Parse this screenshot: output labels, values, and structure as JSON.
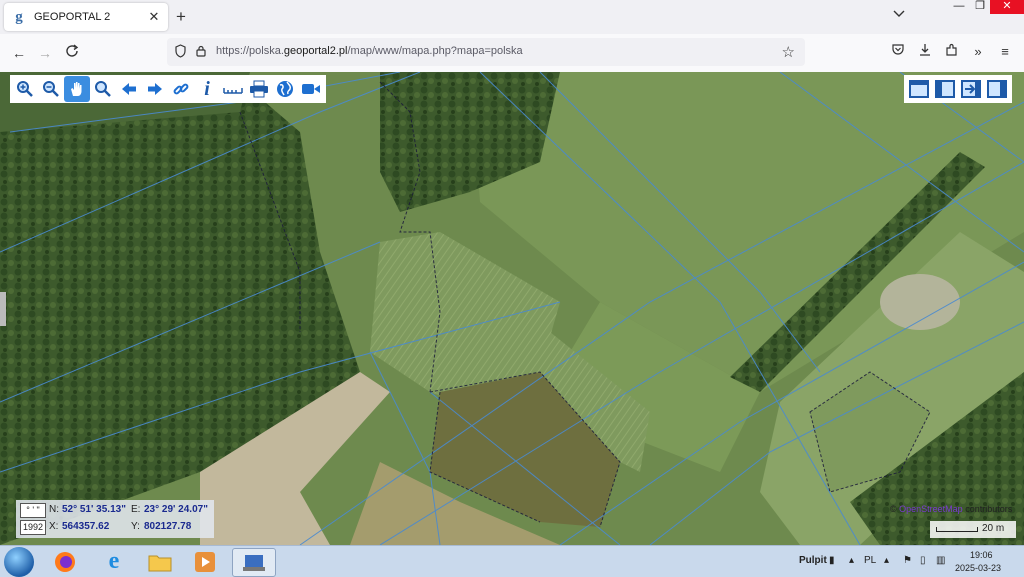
{
  "browser": {
    "tab_title": "GEOPORTAL 2",
    "favicon": "g",
    "new_tab": "+",
    "url_prefix": "https://polska.",
    "url_domain": "geoportal2.pl",
    "url_path": "/map/www/mapa.php?mapa=polska",
    "window_controls": [
      "—",
      "❐",
      "✕"
    ]
  },
  "map": {
    "toolbar_left": [
      "zoom-in-icon",
      "zoom-out-icon",
      "pan-hand-icon",
      "zoom-box-icon",
      "back-arrow-icon",
      "forward-arrow-icon",
      "link-icon",
      "info-icon",
      "measure-icon",
      "print-icon",
      "globe-icon",
      "video-icon"
    ],
    "toolbar_right": [
      "panel-full-icon",
      "panel-left-icon",
      "panel-export-icon",
      "panel-right-icon"
    ],
    "coords": {
      "sys_button": "° ' \"",
      "sys_code": "1992",
      "n_label": "N:",
      "n_value": "52° 51' 35.13\"",
      "e_label": "E:",
      "e_value": "23° 29' 24.07\"",
      "x_label": "X:",
      "x_value": "564357.62",
      "y_label": "Y:",
      "y_value": "802127.78"
    },
    "attribution_prefix": "©",
    "attribution_link": "OpenStreetMap",
    "attribution_suffix": "contributors",
    "scale_label": "20 m"
  },
  "taskbar": {
    "tray_label": "Pulpit",
    "lang": "PL",
    "time": "19:06",
    "date": "2025-03-23"
  }
}
